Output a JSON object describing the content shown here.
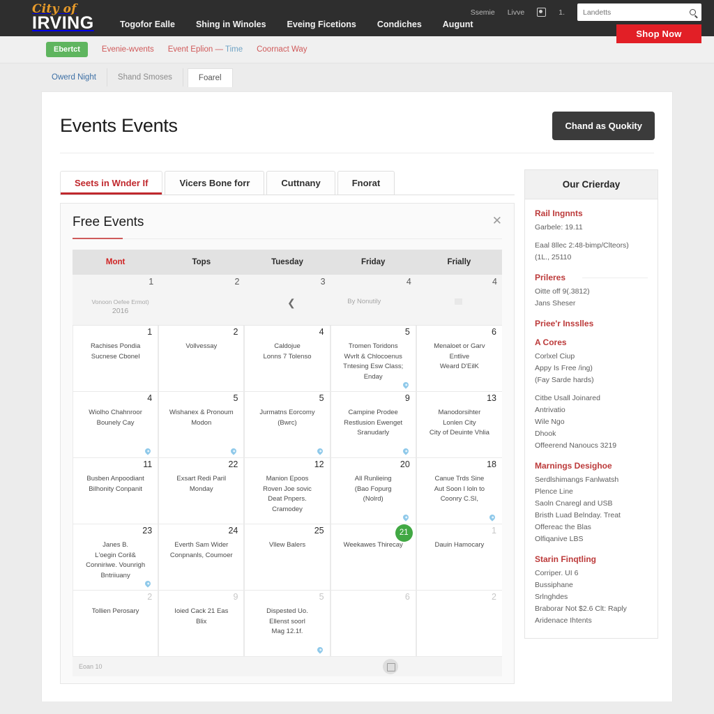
{
  "topbar": {
    "logo_top": "City of",
    "logo_bottom": "IRVING",
    "nav": [
      {
        "label": "Togofor Ealle"
      },
      {
        "label": "Shing in Winoles"
      },
      {
        "label": "Eveing Ficetions"
      },
      {
        "label": "Condiches"
      },
      {
        "label": "Augunt"
      }
    ],
    "utility": [
      {
        "label": "Ssemie"
      },
      {
        "label": "Livve"
      },
      {
        "label": "1."
      }
    ],
    "utility_icon": "card-icon",
    "search_placeholder": "Landetts",
    "search_value": "",
    "search_icon": "search-icon",
    "shop_now": "Shop Now",
    "accent_red": "#e21f26",
    "logo_orange": "#e89b2a"
  },
  "subnav": {
    "pill": "Ebertct",
    "links": [
      {
        "label": "Evenie-wvents",
        "accent": ""
      },
      {
        "label": "Event Eplion — ",
        "accent": "Time"
      },
      {
        "label": "Coornact Way",
        "accent": ""
      }
    ]
  },
  "breadcrumbs": [
    {
      "label": "Owerd Night",
      "state": "active"
    },
    {
      "label": "Shand Smoses",
      "state": "normal"
    },
    {
      "label": "Foarel",
      "state": "boxed"
    }
  ],
  "page": {
    "title": "Events Events",
    "quantity_button": "Chand as Quokity"
  },
  "tabs": [
    {
      "label": "Seets in Wnder If",
      "selected": true
    },
    {
      "label": "Vicers Bone forr",
      "selected": false
    },
    {
      "label": "Cuttnany",
      "selected": false
    },
    {
      "label": "Fnorat",
      "selected": false
    }
  ],
  "panel": {
    "title": "Free Events",
    "close_icon": "close-icon"
  },
  "calendar": {
    "weekday_headers": [
      {
        "label": "Mont",
        "highlight": true
      },
      {
        "label": "Tops",
        "highlight": false
      },
      {
        "label": "Tuesday",
        "highlight": false
      },
      {
        "label": "Friday",
        "highlight": false
      },
      {
        "label": "Frially",
        "highlight": false
      }
    ],
    "nav_row": {
      "numbers": [
        "1",
        "2",
        "3",
        "4",
        "4"
      ],
      "label_line1": "Vonoon Oefee Ermot)",
      "label_line2": "2016",
      "prev_icon": "chevron-left-icon",
      "month_label": "By Nonutily"
    },
    "weeks": [
      [
        {
          "num": "1",
          "muted": false,
          "today": false,
          "pin": false,
          "lines": [
            "Rachises Pondia",
            "Sucnese Cbonel"
          ]
        },
        {
          "num": "2",
          "muted": false,
          "today": false,
          "pin": false,
          "lines": [
            "Vollvessay"
          ]
        },
        {
          "num": "4",
          "muted": false,
          "today": false,
          "pin": false,
          "lines": [
            "Caldojue",
            "Lonns 7 Tolenso"
          ]
        },
        {
          "num": "5",
          "muted": false,
          "today": false,
          "pin": true,
          "lines": [
            "Tromen Toridons",
            "Wvrlt & Chlocoenus",
            "Tntesing Esw Class;",
            "Enday"
          ]
        },
        {
          "num": "6",
          "muted": false,
          "today": false,
          "pin": false,
          "lines": [
            "Menaloet or Garv",
            "Entlive",
            "Weard D'EilK"
          ]
        }
      ],
      [
        {
          "num": "4",
          "muted": false,
          "today": false,
          "pin": true,
          "lines": [
            "Wiolho Chahnroor",
            "Bounely Cay"
          ]
        },
        {
          "num": "5",
          "muted": false,
          "today": false,
          "pin": true,
          "lines": [
            "Wishanex & Pronoum",
            "Modon"
          ]
        },
        {
          "num": "5",
          "muted": false,
          "today": false,
          "pin": true,
          "lines": [
            "Jurmatns Eorcomy",
            "(Bwrc)"
          ]
        },
        {
          "num": "9",
          "muted": false,
          "today": false,
          "pin": true,
          "lines": [
            "Campine Prodee",
            "Restlusion Ewenget",
            "Sranudarly"
          ]
        },
        {
          "num": "13",
          "muted": false,
          "today": false,
          "pin": false,
          "lines": [
            "Manodorsihter",
            "Lonlen City",
            "City of Deuinte Vhlia"
          ]
        }
      ],
      [
        {
          "num": "11",
          "muted": false,
          "today": false,
          "pin": false,
          "lines": [
            "Busben Anpoodiant",
            "Bilhonity Conpanit"
          ]
        },
        {
          "num": "22",
          "muted": false,
          "today": false,
          "pin": false,
          "lines": [
            "Exsart Redi Paril",
            "Monday"
          ]
        },
        {
          "num": "12",
          "muted": false,
          "today": false,
          "pin": false,
          "lines": [
            "Manion Epoos",
            "Roven Joe sovic",
            "Deat Pnpers.",
            "Cramodey"
          ]
        },
        {
          "num": "20",
          "muted": false,
          "today": false,
          "pin": true,
          "lines": [
            "All Runlieing",
            "(Bao Fopurg",
            "(Nolrd)"
          ]
        },
        {
          "num": "18",
          "muted": false,
          "today": false,
          "pin": true,
          "lines": [
            "Canue Trds Sine",
            "Aut Soon I loln to",
            "Coonry C.SI,"
          ]
        }
      ],
      [
        {
          "num": "23",
          "muted": false,
          "today": false,
          "pin": true,
          "lines": [
            "Janes B.",
            "L'oegin Coril&",
            "Conniriwe. Vounrigh",
            "Bntriiuany"
          ]
        },
        {
          "num": "24",
          "muted": false,
          "today": false,
          "pin": false,
          "lines": [
            "Everth Sam Wider",
            "Conpnanls, Coumoer"
          ]
        },
        {
          "num": "25",
          "muted": false,
          "today": false,
          "pin": false,
          "lines": [
            "Vllew Balers"
          ]
        },
        {
          "num": "21",
          "muted": false,
          "today": true,
          "pin": false,
          "lines": [
            "Weekawes Thirecay"
          ]
        },
        {
          "num": "1",
          "muted": true,
          "today": false,
          "pin": false,
          "lines": [
            "Dauin Hamocary"
          ]
        }
      ],
      [
        {
          "num": "2",
          "muted": true,
          "today": false,
          "pin": false,
          "lines": [
            "Tollien Perosary"
          ]
        },
        {
          "num": "9",
          "muted": true,
          "today": false,
          "pin": false,
          "lines": [
            "Ioied Cack 21 Eas",
            "Blix"
          ]
        },
        {
          "num": "5",
          "muted": true,
          "today": false,
          "pin": true,
          "lines": [
            "Dispested Uo.",
            "Ellenst soorl",
            "Mag 12.1f."
          ]
        },
        {
          "num": "6",
          "muted": true,
          "today": false,
          "pin": false,
          "lines": []
        },
        {
          "num": "2",
          "muted": true,
          "today": false,
          "pin": false,
          "lines": []
        }
      ]
    ],
    "footer_label": "Eoan 10",
    "footer_icon": "calendar-icon"
  },
  "aside": {
    "header": "Our Crierday",
    "sections": [
      {
        "title": "Rail Ingnnts",
        "ruled": false,
        "groups": [
          [
            "Garbele: 19.11"
          ],
          [
            "Eaal 8llec 2:48-bimp/Clteors)",
            "(1L., 25110"
          ]
        ]
      },
      {
        "title": "Prileres",
        "ruled": true,
        "groups": [
          [
            "Oitte off 9(.3812)",
            "Jans Sheser"
          ]
        ]
      },
      {
        "title": "Priee'r Insslles",
        "ruled": false,
        "groups": []
      },
      {
        "title": "A Cores",
        "ruled": false,
        "groups": [
          [
            "Corlxel Ciup",
            "Appy Is Free /ing)",
            "(Fay Sarde hards)"
          ],
          [
            "Citbe Usall Joinared",
            "Antrivatio",
            "Wile Ngo",
            "Dhook",
            "Offeerend Nanoucs 3219"
          ]
        ]
      },
      {
        "title": "Marnings Desighoe",
        "ruled": false,
        "groups": [
          [
            "Serdlshimangs Fanlwatsh",
            "Plence Line",
            "Saoln Cnaregl and USB",
            "Bristh Luad Belnday. Treat",
            "Offereac the Blas",
            "Olfiqanive LBS"
          ]
        ]
      },
      {
        "title": "Starin Finqtling",
        "ruled": false,
        "groups": [
          [
            "Corriper. UI 6",
            "Bussiphane",
            "Srlnghdes",
            "Braborar Not $2.6 Clt: Raply",
            "Aridenace Ihtents"
          ]
        ]
      }
    ]
  }
}
